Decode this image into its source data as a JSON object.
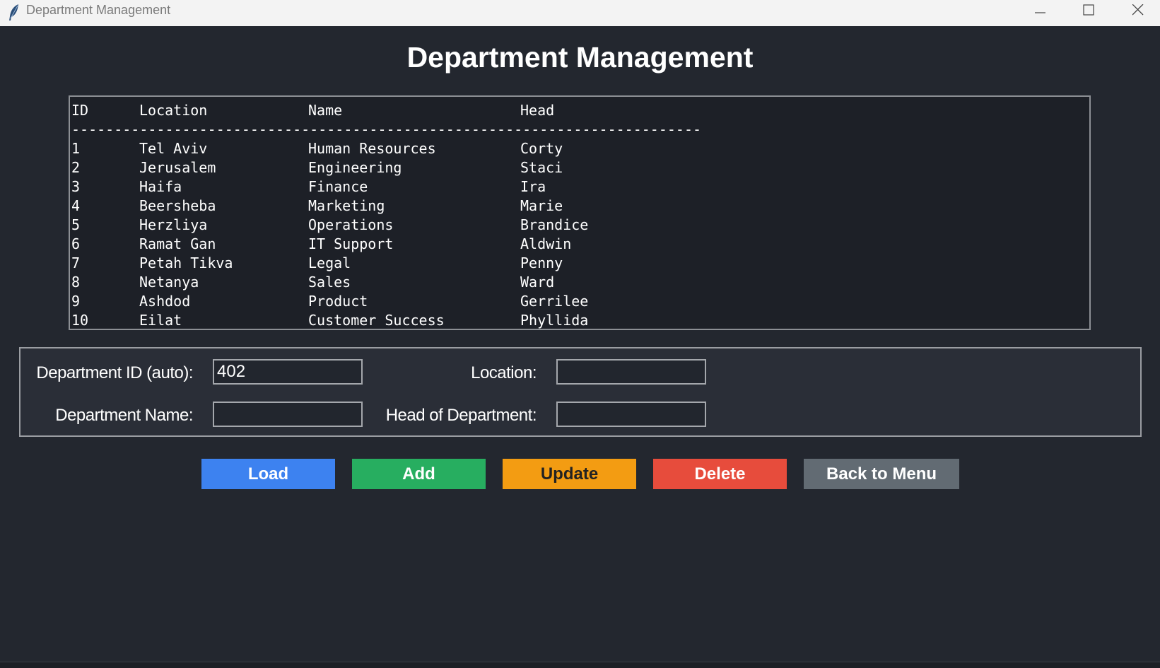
{
  "window": {
    "title": "Department Management",
    "icon": "feather-icon",
    "controls": [
      "minimize-icon",
      "maximize-icon",
      "close-icon"
    ]
  },
  "page": {
    "title": "Department Management"
  },
  "listbox": {
    "columns": [
      "ID",
      "Location",
      "Name",
      "Head"
    ],
    "separator": "--------------------------------------------------------------------------",
    "rows": [
      {
        "id": "1",
        "location": "Tel Aviv",
        "name": "Human Resources",
        "head": "Corty"
      },
      {
        "id": "2",
        "location": "Jerusalem",
        "name": "Engineering",
        "head": "Staci"
      },
      {
        "id": "3",
        "location": "Haifa",
        "name": "Finance",
        "head": "Ira"
      },
      {
        "id": "4",
        "location": "Beersheba",
        "name": "Marketing",
        "head": "Marie"
      },
      {
        "id": "5",
        "location": "Herzliya",
        "name": "Operations",
        "head": "Brandice"
      },
      {
        "id": "6",
        "location": "Ramat Gan",
        "name": "IT Support",
        "head": "Aldwin"
      },
      {
        "id": "7",
        "location": "Petah Tikva",
        "name": "Legal",
        "head": "Penny"
      },
      {
        "id": "8",
        "location": "Netanya",
        "name": "Sales",
        "head": "Ward"
      },
      {
        "id": "9",
        "location": "Ashdod",
        "name": "Product",
        "head": "Gerrilee"
      },
      {
        "id": "10",
        "location": "Eilat",
        "name": "Customer Success",
        "head": "Phyllida"
      }
    ]
  },
  "form": {
    "dept_id_label": "Department ID (auto):",
    "dept_id_value": "402",
    "location_label": "Location:",
    "location_value": "",
    "dept_name_label": "Department Name:",
    "dept_name_value": "",
    "head_label": "Head of Department:",
    "head_value": ""
  },
  "buttons": {
    "load": "Load",
    "add": "Add",
    "update": "Update",
    "delete": "Delete",
    "back": "Back to Menu"
  },
  "colors": {
    "background": "#23272f",
    "load": "#3d82f0",
    "add": "#27ae60",
    "update": "#f39c12",
    "delete": "#e74c3c",
    "back": "#626b73"
  }
}
